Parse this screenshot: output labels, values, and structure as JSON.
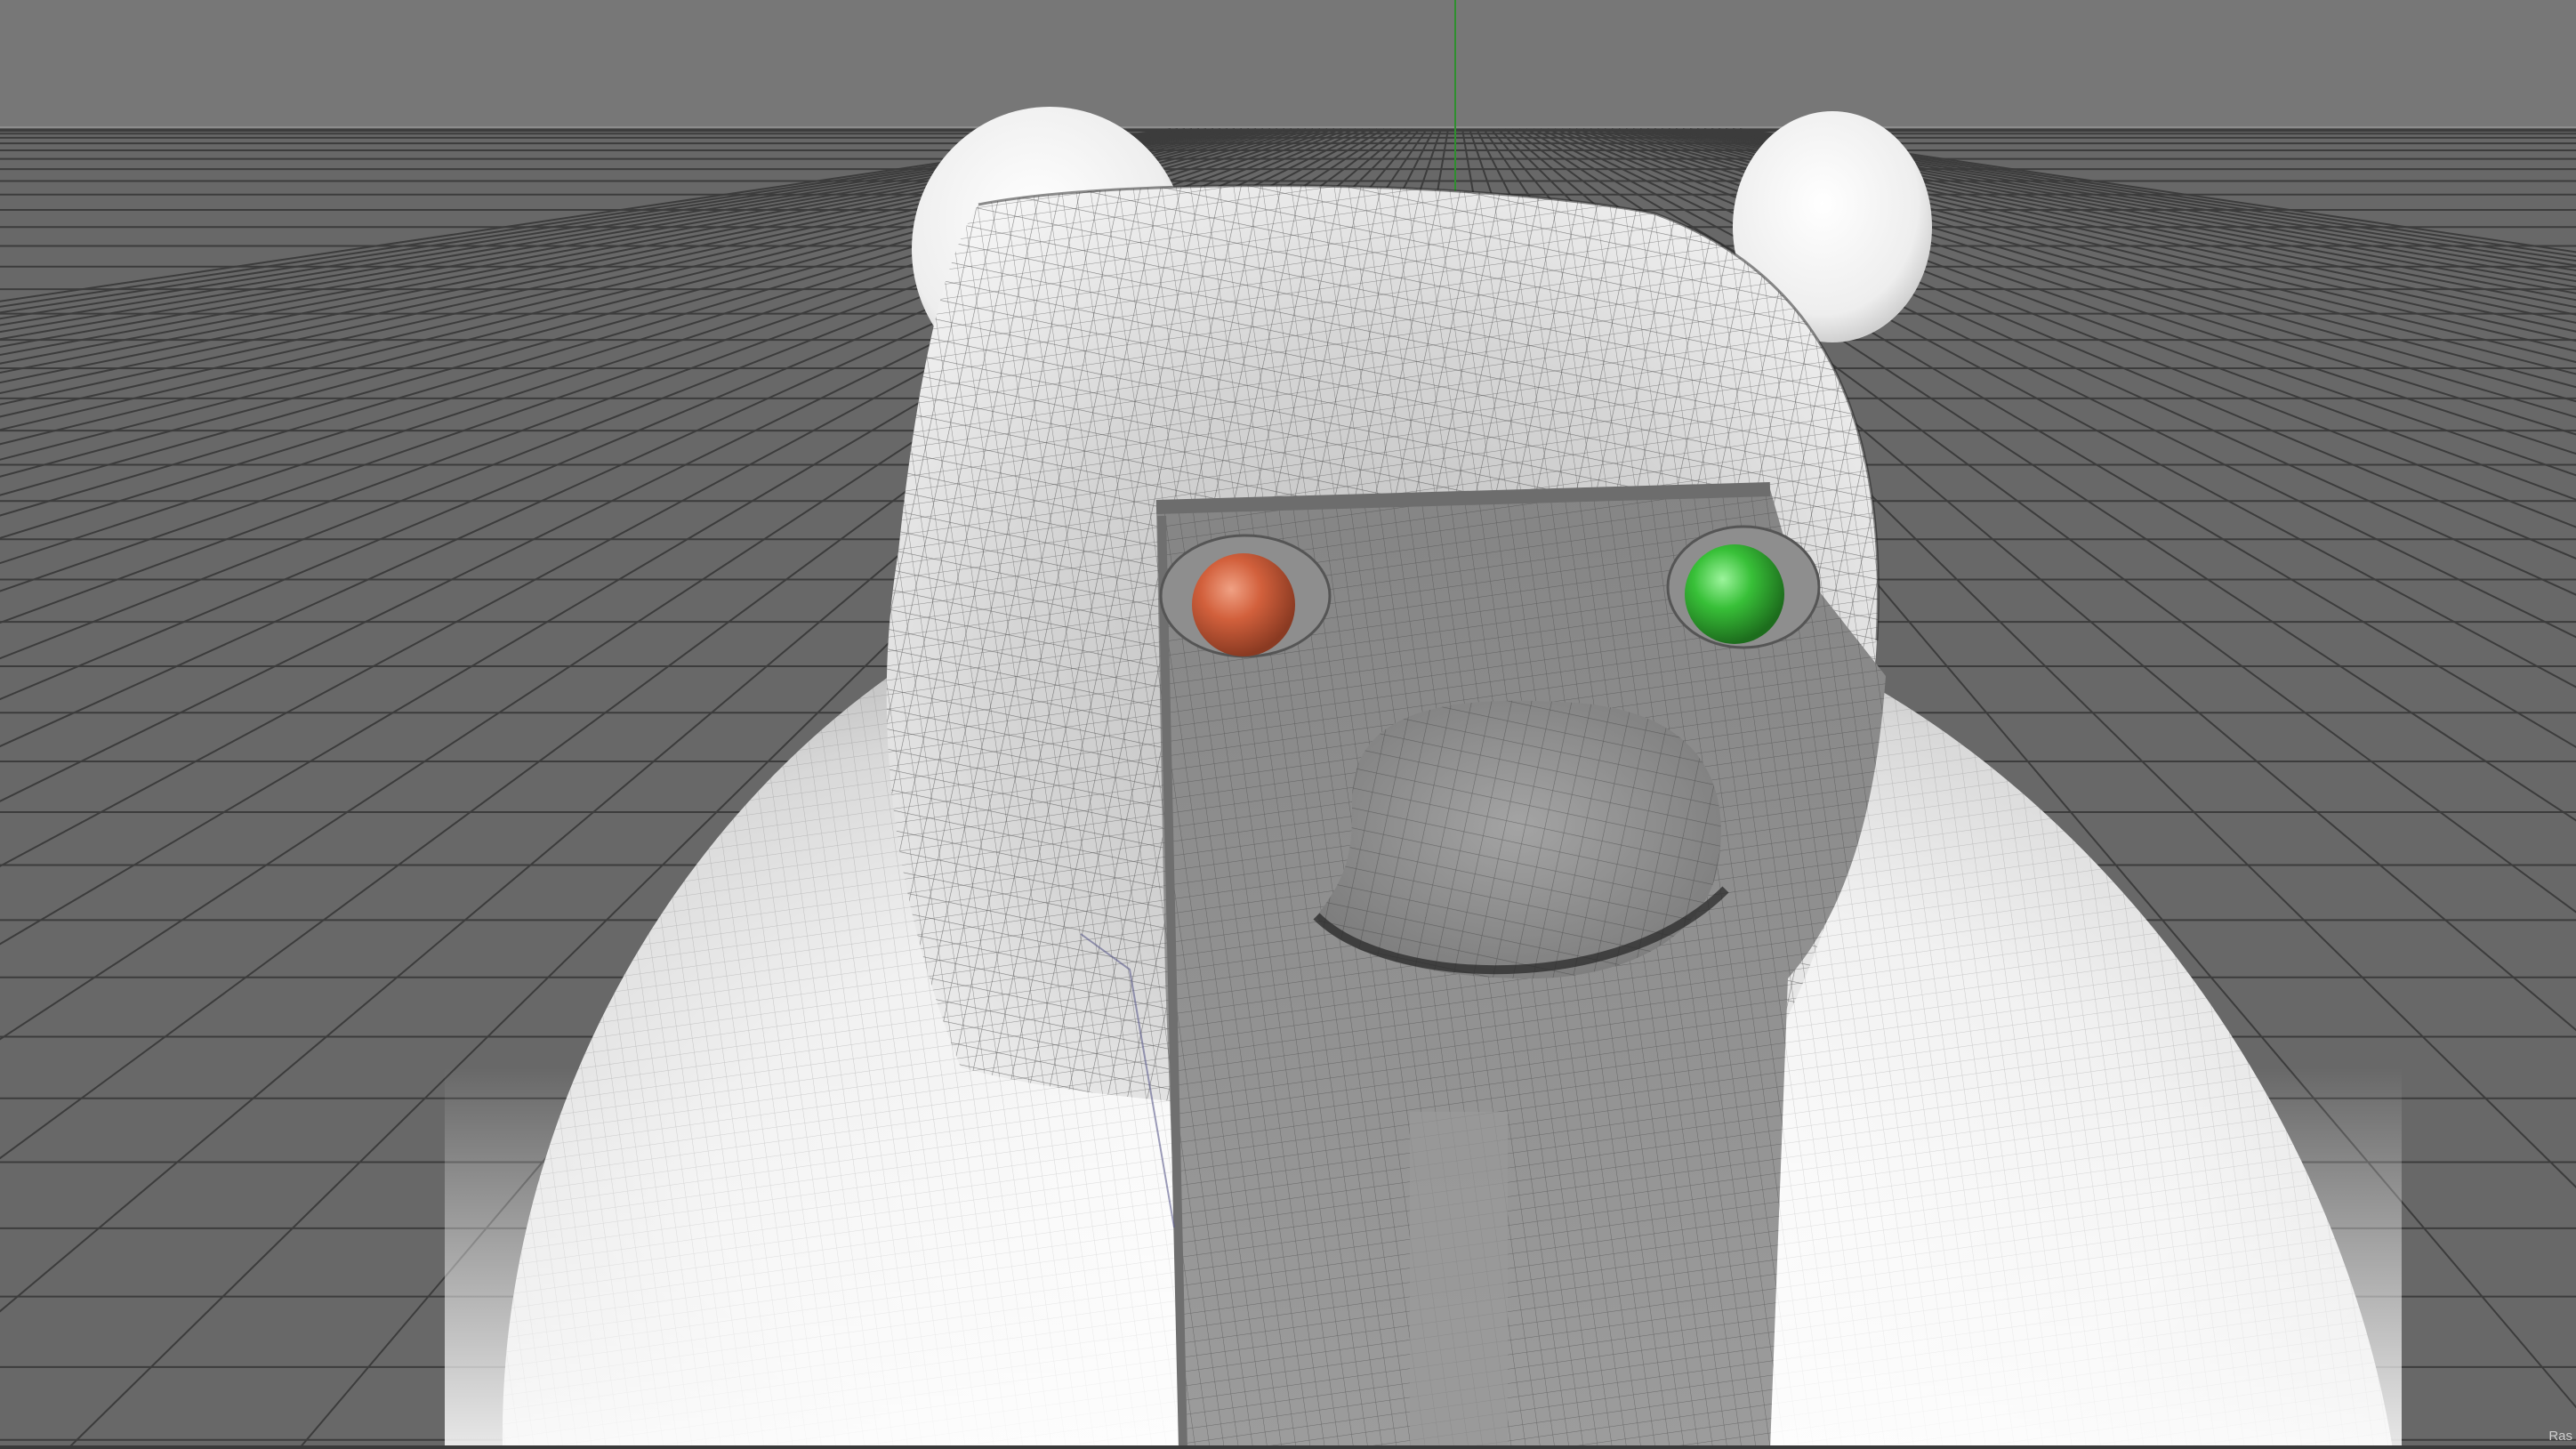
{
  "viewport": {
    "status_label": "Ras",
    "colors": {
      "background": "#6a6a6a",
      "grid_line": "#3c3c3c",
      "horizon_line": "#8c8c8c",
      "y_axis": "#2f8f2f",
      "model_surface": "#f2f2f2",
      "face_plate": "#7a7a7a",
      "left_eye": "#d2603c",
      "right_eye": "#38c038"
    },
    "objects": [
      {
        "name": "floor-grid",
        "icon": "grid"
      },
      {
        "name": "bear-model",
        "icon": "mesh"
      },
      {
        "name": "left-eye-sphere",
        "icon": "sphere"
      },
      {
        "name": "right-eye-sphere",
        "icon": "sphere"
      }
    ]
  }
}
